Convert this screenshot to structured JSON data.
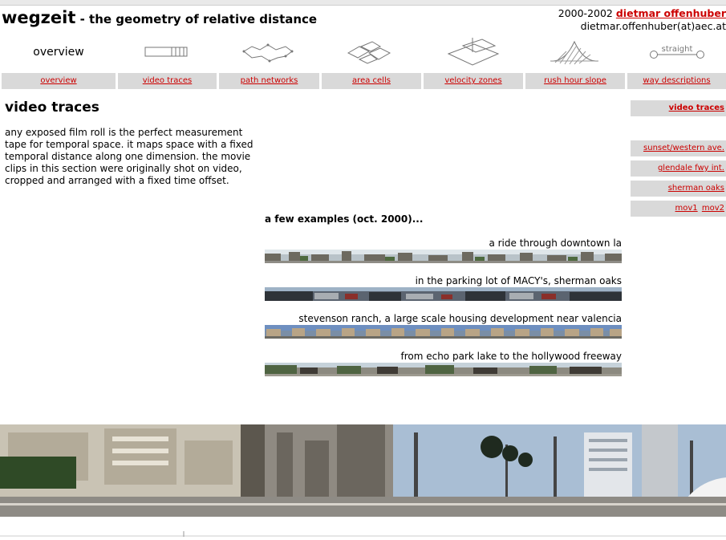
{
  "header": {
    "brand": "wegzeit",
    "tagline": " - the geometry of relative distance",
    "years": "2000-2002 ",
    "author": "dietmar offenhuber",
    "email": "dietmar.offenhuber(at)aec.at"
  },
  "icons": {
    "overview": "overview",
    "straight": "straight"
  },
  "nav": {
    "tabs": [
      "overview",
      "video traces",
      "path networks",
      "area cells",
      "velocity zones",
      "rush hour slope",
      "way descriptions"
    ]
  },
  "main": {
    "title": "video traces",
    "intro": "any exposed film roll is the perfect measurement tape for temporal space. it maps space with a fixed temporal distance along one dimension. the movie clips in this section were originally shot on video, cropped and arranged with a fixed time offset.",
    "examples_title": "a few examples (oct. 2000)...",
    "examples": [
      "a ride through downtown la",
      "in the parking lot of MACY's, sherman oaks",
      "stevenson ranch, a large scale housing development near valencia",
      "from echo park lake to the hollywood freeway"
    ]
  },
  "sidebar": {
    "current": "video traces",
    "links": [
      "sunset/western ave.",
      "glendale fwy int.",
      "sherman oaks"
    ],
    "movies": [
      "mov1",
      "mov2"
    ]
  },
  "colors": {
    "link": "#cc0000",
    "tab_bg": "#d9d9d9"
  }
}
